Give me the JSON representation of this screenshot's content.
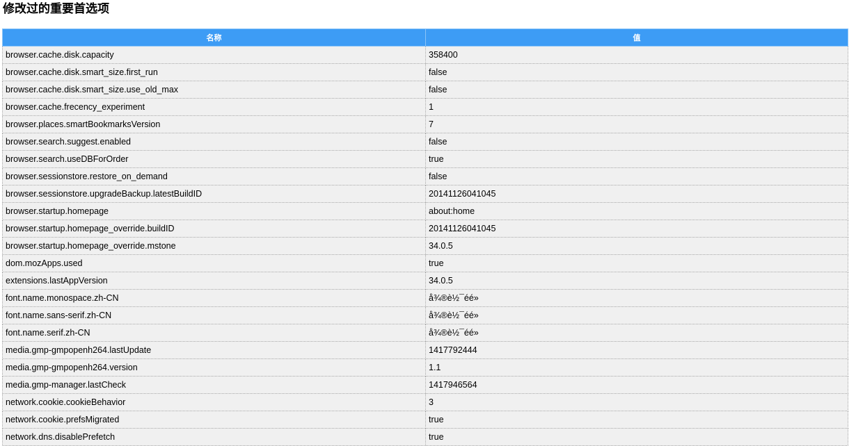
{
  "page": {
    "title": "修改过的重要首选项"
  },
  "table": {
    "columns": [
      "名称",
      "值"
    ],
    "rows": [
      {
        "name": "browser.cache.disk.capacity",
        "value": "358400"
      },
      {
        "name": "browser.cache.disk.smart_size.first_run",
        "value": "false"
      },
      {
        "name": "browser.cache.disk.smart_size.use_old_max",
        "value": "false"
      },
      {
        "name": "browser.cache.frecency_experiment",
        "value": "1"
      },
      {
        "name": "browser.places.smartBookmarksVersion",
        "value": "7"
      },
      {
        "name": "browser.search.suggest.enabled",
        "value": "false"
      },
      {
        "name": "browser.search.useDBForOrder",
        "value": "true"
      },
      {
        "name": "browser.sessionstore.restore_on_demand",
        "value": "false"
      },
      {
        "name": "browser.sessionstore.upgradeBackup.latestBuildID",
        "value": "20141126041045"
      },
      {
        "name": "browser.startup.homepage",
        "value": "about:home"
      },
      {
        "name": "browser.startup.homepage_override.buildID",
        "value": "20141126041045"
      },
      {
        "name": "browser.startup.homepage_override.mstone",
        "value": "34.0.5"
      },
      {
        "name": "dom.mozApps.used",
        "value": "true"
      },
      {
        "name": "extensions.lastAppVersion",
        "value": "34.0.5"
      },
      {
        "name": "font.name.monospace.zh-CN",
        "value": "å¾®è½¯éé»"
      },
      {
        "name": "font.name.sans-serif.zh-CN",
        "value": "å¾®è½¯éé»"
      },
      {
        "name": "font.name.serif.zh-CN",
        "value": "å¾®è½¯éé»"
      },
      {
        "name": "media.gmp-gmpopenh264.lastUpdate",
        "value": "1417792444"
      },
      {
        "name": "media.gmp-gmpopenh264.version",
        "value": "1.1"
      },
      {
        "name": "media.gmp-manager.lastCheck",
        "value": "1417946564"
      },
      {
        "name": "network.cookie.cookieBehavior",
        "value": "3"
      },
      {
        "name": "network.cookie.prefsMigrated",
        "value": "true"
      },
      {
        "name": "network.dns.disablePrefetch",
        "value": "true"
      }
    ]
  },
  "colors": {
    "header_bg": "#3d9cf5",
    "header_text": "#ffffff",
    "row_bg": "#f0f0f0"
  }
}
